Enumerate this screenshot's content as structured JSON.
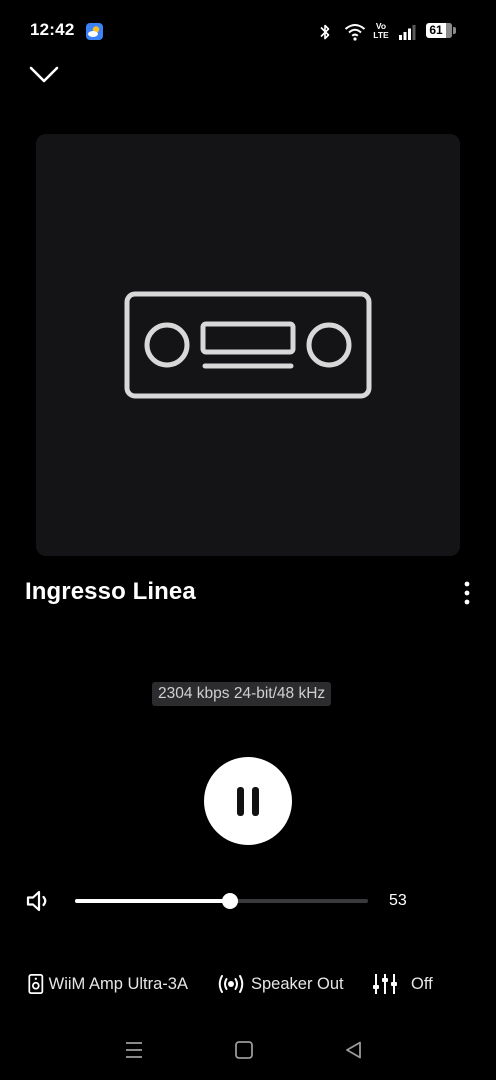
{
  "status_bar": {
    "time": "12:42",
    "battery": "61",
    "icons": [
      "weather-icon",
      "bluetooth-icon",
      "wifi-icon",
      "volte-icon",
      "signal-icon",
      "battery-icon"
    ],
    "volte_top": "Vo",
    "volte_bottom": "LTE"
  },
  "player": {
    "collapse_icon": "chevron-down-icon",
    "artwork_icon": "radio-icon",
    "title": "Ingresso Linea",
    "more_icon": "more-vertical-icon",
    "quality": "2304 kbps 24-bit/48 kHz",
    "state": "playing",
    "play_pause_icon": "pause-icon"
  },
  "volume": {
    "icon": "speaker-icon",
    "value": "53",
    "level_fraction": 0.53
  },
  "bottom_bar": {
    "device_label": "WiiM Amp Ultra-3A",
    "device_icon": "speaker-device-icon",
    "output_label": "Speaker Out",
    "output_icon": "broadcast-icon",
    "eq_label": "Off",
    "eq_icon": "equalizer-icon"
  },
  "nav_bar": {
    "icons": [
      "menu-icon",
      "home-icon",
      "back-icon"
    ]
  },
  "colors": {
    "background": "#000000",
    "artwork_bg": "#141417",
    "accent": "#ffffff",
    "track_bg": "#3a3a3c",
    "badge_bg": "#2c2c2e"
  }
}
